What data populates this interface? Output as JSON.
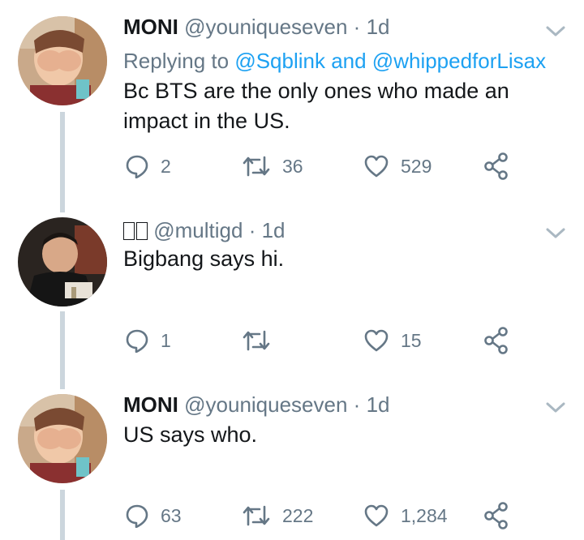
{
  "tweets": [
    {
      "name": "MONI",
      "handle": "@youniqueseven",
      "dot": "·",
      "time": "1d",
      "reply_prefix": "Replying to ",
      "reply_link": "@Sqblink and @whippedforLisax",
      "text_line1": "Bc BTS are the only ones who made an",
      "text_line2": "impact in the US.",
      "replies": "2",
      "retweets": "36",
      "likes": "529",
      "avatar_icon": "person-covering-face-avatar"
    },
    {
      "name": "",
      "handle": "@multigd",
      "dot": "·",
      "time": "1d",
      "text_line1": "Bigbang says hi.",
      "replies": "1",
      "retweets": "",
      "likes": "15",
      "avatar_icon": "person-laughing-avatar"
    },
    {
      "name": "MONI",
      "handle": "@youniqueseven",
      "dot": "·",
      "time": "1d",
      "text_line1": "US says who.",
      "replies": "63",
      "retweets": "222",
      "likes": "1,284",
      "avatar_icon": "person-covering-face-avatar"
    }
  ],
  "colors": {
    "text": "#14171a",
    "secondary": "#657786",
    "link": "#1da1f2",
    "thread_line": "#ccd6dd"
  }
}
